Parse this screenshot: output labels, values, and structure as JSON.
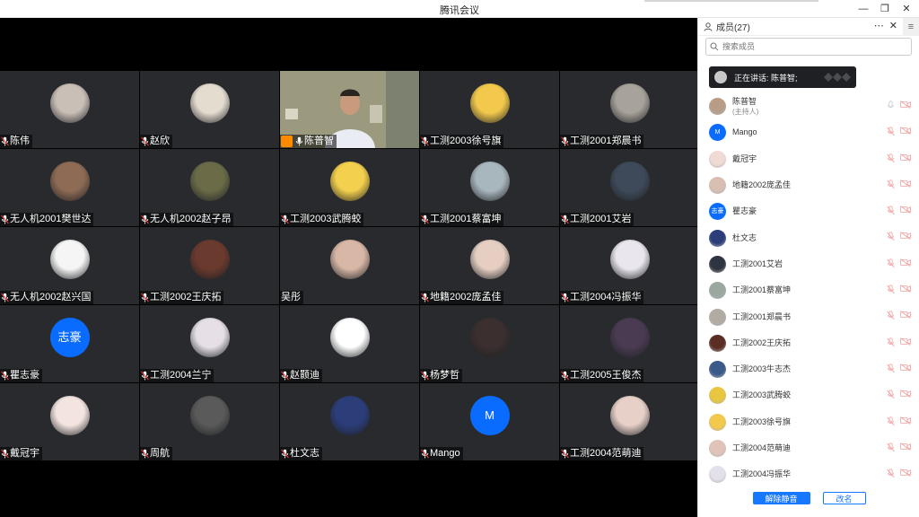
{
  "window": {
    "title": "腾讯会议"
  },
  "tiles": [
    {
      "name": "陈伟",
      "avatar": "photo",
      "color": "#c9bfb7"
    },
    {
      "name": "赵欣",
      "avatar": "photo",
      "color": "#e4dccf"
    },
    {
      "name": "陈普智",
      "avatar": "video",
      "color": "#8a8f7c",
      "active": true,
      "host": true
    },
    {
      "name": "工测2003徐号旗",
      "avatar": "photo",
      "color": "#f2c94c"
    },
    {
      "name": "工测2001郑晨书",
      "avatar": "photo",
      "color": "#a7a29a"
    },
    {
      "name": "无人机2001樊世达",
      "avatar": "photo",
      "color": "#8e6b55"
    },
    {
      "name": "无人机2002赵子昂",
      "avatar": "photo",
      "color": "#6b6b48"
    },
    {
      "name": "工测2003武腾蛟",
      "avatar": "photo",
      "color": "#f3d04d"
    },
    {
      "name": "工测2001蔡富坤",
      "avatar": "photo",
      "color": "#a8b6bd"
    },
    {
      "name": "工测2001艾岩",
      "avatar": "photo",
      "color": "#3e4a5a"
    },
    {
      "name": "无人机2002赵兴国",
      "avatar": "photo",
      "color": "#f5f5f5"
    },
    {
      "name": "工测2002王庆拓",
      "avatar": "photo",
      "color": "#6a3a2e"
    },
    {
      "name": "吴彤",
      "avatar": "photo",
      "color": "#d8b7a6",
      "nomic": true
    },
    {
      "name": "地籍2002庞孟佳",
      "avatar": "photo",
      "color": "#e6cfc2"
    },
    {
      "name": "工测2004冯振华",
      "avatar": "photo",
      "color": "#e9e6ee"
    },
    {
      "name": "瞿志豪",
      "avatar": "initial",
      "initial": "志豪",
      "color": "#0a6cff"
    },
    {
      "name": "工测2004兰宁",
      "avatar": "photo",
      "color": "#e6e0e6"
    },
    {
      "name": "赵颢迪",
      "avatar": "photo",
      "color": "#ffffff"
    },
    {
      "name": "杨梦哲",
      "avatar": "photo",
      "color": "#3b2f2f"
    },
    {
      "name": "工测2005王俊杰",
      "avatar": "photo",
      "color": "#4a3b52"
    },
    {
      "name": "戴冠宇",
      "avatar": "photo",
      "color": "#f3e4e0"
    },
    {
      "name": "周航",
      "avatar": "photo",
      "color": "#5a5a5a"
    },
    {
      "name": "杜文志",
      "avatar": "photo",
      "color": "#2c3e7a"
    },
    {
      "name": "Mango",
      "avatar": "initial",
      "initial": "M",
      "color": "#0a6cff"
    },
    {
      "name": "工测2004范萌迪",
      "avatar": "photo",
      "color": "#e7d0c8"
    }
  ],
  "panel": {
    "title": "成员(27)",
    "search_placeholder": "搜索成员",
    "speaking_label": "正在讲话: 陈普智;",
    "members": [
      {
        "name": "陈普智",
        "sub": "(主持人)",
        "avatar": "photo",
        "color": "#b79d88",
        "mic": "on"
      },
      {
        "name": "Mango",
        "avatar": "initial",
        "initial": "M",
        "color": "#0a6cff"
      },
      {
        "name": "戴冠宇",
        "avatar": "photo",
        "color": "#f0dad4"
      },
      {
        "name": "地籍2002庞孟佳",
        "avatar": "photo",
        "color": "#d9bfb2"
      },
      {
        "name": "瞿志豪",
        "avatar": "initial",
        "initial": "志豪",
        "color": "#0a6cff"
      },
      {
        "name": "杜文志",
        "avatar": "photo",
        "color": "#2c3e7a"
      },
      {
        "name": "工测2001艾岩",
        "avatar": "photo",
        "color": "#2e3440"
      },
      {
        "name": "工测2001蔡富坤",
        "avatar": "photo",
        "color": "#9aa8a0"
      },
      {
        "name": "工测2001郑晨书",
        "avatar": "photo",
        "color": "#b1aba2"
      },
      {
        "name": "工测2002王庆拓",
        "avatar": "photo",
        "color": "#5a2e25"
      },
      {
        "name": "工测2003牛志杰",
        "avatar": "photo",
        "color": "#3a5a8a"
      },
      {
        "name": "工测2003武腾蛟",
        "avatar": "photo",
        "color": "#e8c640"
      },
      {
        "name": "工测2003徐号旗",
        "avatar": "photo",
        "color": "#f2c94c"
      },
      {
        "name": "工测2004范萌迪",
        "avatar": "photo",
        "color": "#e0c4ba"
      },
      {
        "name": "工测2004冯振华",
        "avatar": "photo",
        "color": "#e4e0ea"
      }
    ],
    "unmute_all": "解除静音",
    "rename": "改名"
  },
  "colors": {
    "accent": "#1677ff",
    "mute_red": "#e53935",
    "tile_bg": "#282a2d",
    "active_border": "#27c26f",
    "host_badge": "#ff8a00"
  }
}
